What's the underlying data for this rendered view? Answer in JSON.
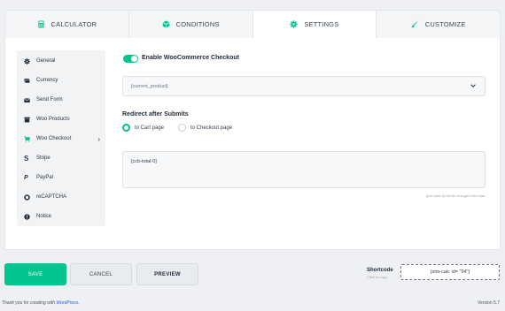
{
  "tabs": [
    {
      "label": "CALCULATOR",
      "icon": "calculator-icon",
      "active": false
    },
    {
      "label": "CONDITIONS",
      "icon": "cube-icon",
      "active": false
    },
    {
      "label": "SETTINGS",
      "icon": "gear-icon",
      "active": true
    },
    {
      "label": "CUSTOMIZE",
      "icon": "brush-icon",
      "active": false
    }
  ],
  "sidebar": {
    "items": [
      {
        "label": "General",
        "icon": "gear-icon"
      },
      {
        "label": "Currency",
        "icon": "money-icon"
      },
      {
        "label": "Send Form",
        "icon": "envelope-icon"
      },
      {
        "label": "Woo Products",
        "icon": "box-icon"
      },
      {
        "label": "Woo Checkout",
        "icon": "cart-icon",
        "active": true
      },
      {
        "label": "Stripe",
        "icon": "stripe-icon"
      },
      {
        "label": "PayPal",
        "icon": "paypal-icon"
      },
      {
        "label": "reCAPTCHA",
        "icon": "recaptcha-icon"
      },
      {
        "label": "Notice",
        "icon": "exclamation-icon"
      }
    ]
  },
  "settings": {
    "enable_label": "Enable WooCommerce Checkout",
    "enabled": true,
    "product_select_value": "[current_product]",
    "redirect_title": "Redirect after Submits",
    "radio_options": [
      "to Cart page",
      "to Checkout page"
    ],
    "radio_selected": "to Cart page",
    "total_text": "[ccb-total-0]",
    "hint": "[ccb-total-0] will be changed into total"
  },
  "actions": {
    "save": "SAVE",
    "cancel": "CANCEL",
    "preview": "PREVIEW"
  },
  "shortcode": {
    "title": "Shortcode",
    "subtitle": "Click to copy",
    "value": "[stm-calc id= \"94\"]"
  },
  "footer": {
    "thank_you": "Thank you for creating with ",
    "wordpress": "WordPress",
    "version": "Version 5.7"
  },
  "colors": {
    "accent": "#00c58e",
    "link": "#2563eb"
  }
}
